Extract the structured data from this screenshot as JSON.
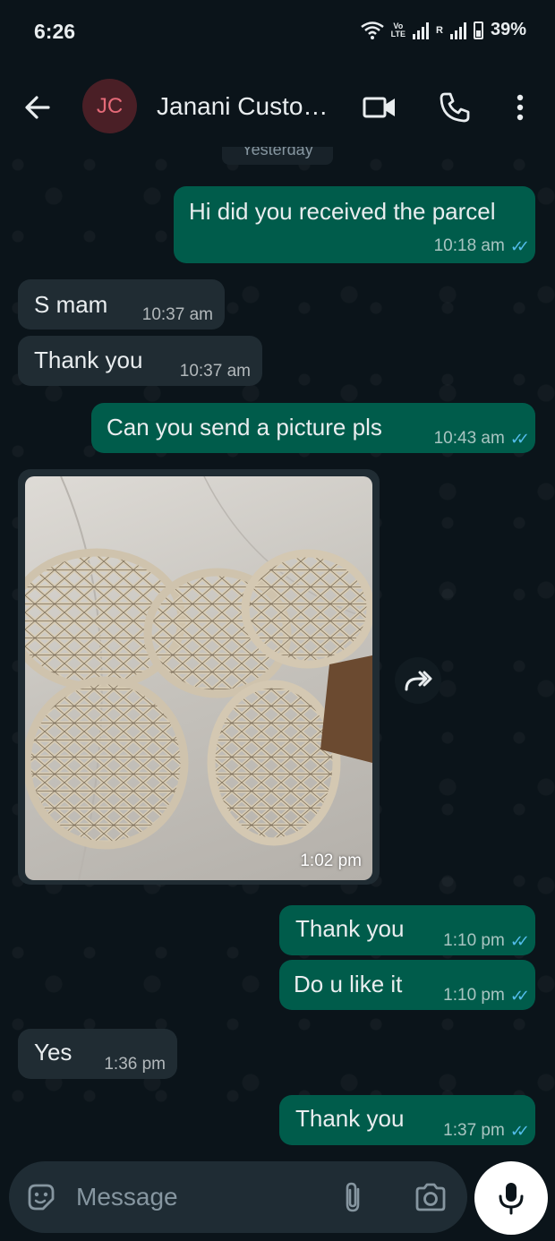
{
  "status_bar": {
    "time": "6:26",
    "volte_top": "Vo",
    "volte_bottom": "LTE",
    "roaming": "R",
    "battery": "39%"
  },
  "header": {
    "avatar_initials": "JC",
    "contact_name": "Janani Custo…"
  },
  "chat": {
    "date_chip": "Yesterday",
    "messages": [
      {
        "direction": "out",
        "text": "Hi did you received the parcel",
        "time": "10:18 am",
        "status": "read"
      },
      {
        "direction": "in",
        "text": "S mam",
        "time": "10:37 am"
      },
      {
        "direction": "in",
        "text": "Thank you",
        "time": "10:37 am"
      },
      {
        "direction": "out",
        "text": "Can you send a picture pls",
        "time": "10:43 am",
        "status": "read"
      },
      {
        "direction": "in",
        "type": "image",
        "time": "1:02 pm"
      },
      {
        "direction": "out",
        "text": "Thank you",
        "time": "1:10 pm",
        "status": "read"
      },
      {
        "direction": "out",
        "text": "Do u like it",
        "time": "1:10 pm",
        "status": "read"
      },
      {
        "direction": "in",
        "text": "Yes",
        "time": "1:36 pm"
      },
      {
        "direction": "out",
        "text": "Thank you",
        "time": "1:37 pm",
        "status": "read"
      }
    ]
  },
  "input": {
    "placeholder": "Message"
  },
  "colors": {
    "background": "#0b141a",
    "outgoing_bubble": "#005c4b",
    "incoming_bubble": "#202c33",
    "read_tick": "#53bdeb",
    "avatar_bg": "#4a1f26",
    "avatar_text": "#e56a78"
  },
  "icons": {
    "back": "arrow-left-icon",
    "video": "video-camera-icon",
    "call": "phone-icon",
    "menu": "more-vertical-icon",
    "emoji": "sticker-icon",
    "attach": "paperclip-icon",
    "camera": "camera-icon",
    "mic": "microphone-icon",
    "forward": "forward-icon"
  }
}
